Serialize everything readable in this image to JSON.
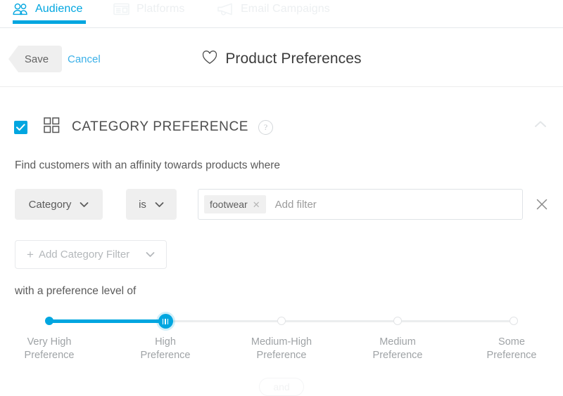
{
  "topnav": {
    "tabs": [
      {
        "label": "Audience",
        "icon": "people-icon",
        "active": true
      },
      {
        "label": "Platforms",
        "icon": "layout-card-icon",
        "active": false
      },
      {
        "label": "Email Campaigns",
        "icon": "megaphone-icon",
        "active": false
      }
    ],
    "accent_color": "#00a6e0"
  },
  "actionbar": {
    "save_label": "Save",
    "cancel_label": "Cancel",
    "page_title": "Product Preferences",
    "title_icon": "heart-outline-icon"
  },
  "section": {
    "checkbox_checked": true,
    "icon": "grid-squares-icon",
    "title": "CATEGORY PREFERENCE",
    "help_icon": "question-mark-icon",
    "help_glyph": "?",
    "collapse_icon": "chevron-up-icon",
    "lead_text": "Find customers with an affinity towards products where",
    "filter": {
      "field_label": "Category",
      "field_caret": "chevron-down-icon",
      "operator_label": "is",
      "operator_caret": "chevron-down-icon",
      "chips": [
        {
          "label": "footwear",
          "remove_icon": "close-icon"
        }
      ],
      "input_placeholder": "Add filter",
      "remove_row_icon": "close-icon"
    },
    "add_filter_label": "Add Category Filter",
    "add_filter_plus": "+",
    "add_filter_caret": "chevron-down-icon",
    "preference_text": "with a preference level of",
    "slider": {
      "selected_index": 1,
      "selected_value": "High Preference",
      "steps": [
        {
          "line1": "Very High",
          "line2": "Preference"
        },
        {
          "line1": "High",
          "line2": "Preference"
        },
        {
          "line1": "Medium-High",
          "line2": "Preference"
        },
        {
          "line1": "Medium",
          "line2": "Preference"
        },
        {
          "line1": "Some",
          "line2": "Preference"
        }
      ]
    }
  },
  "footer": {
    "and_label": "and"
  }
}
